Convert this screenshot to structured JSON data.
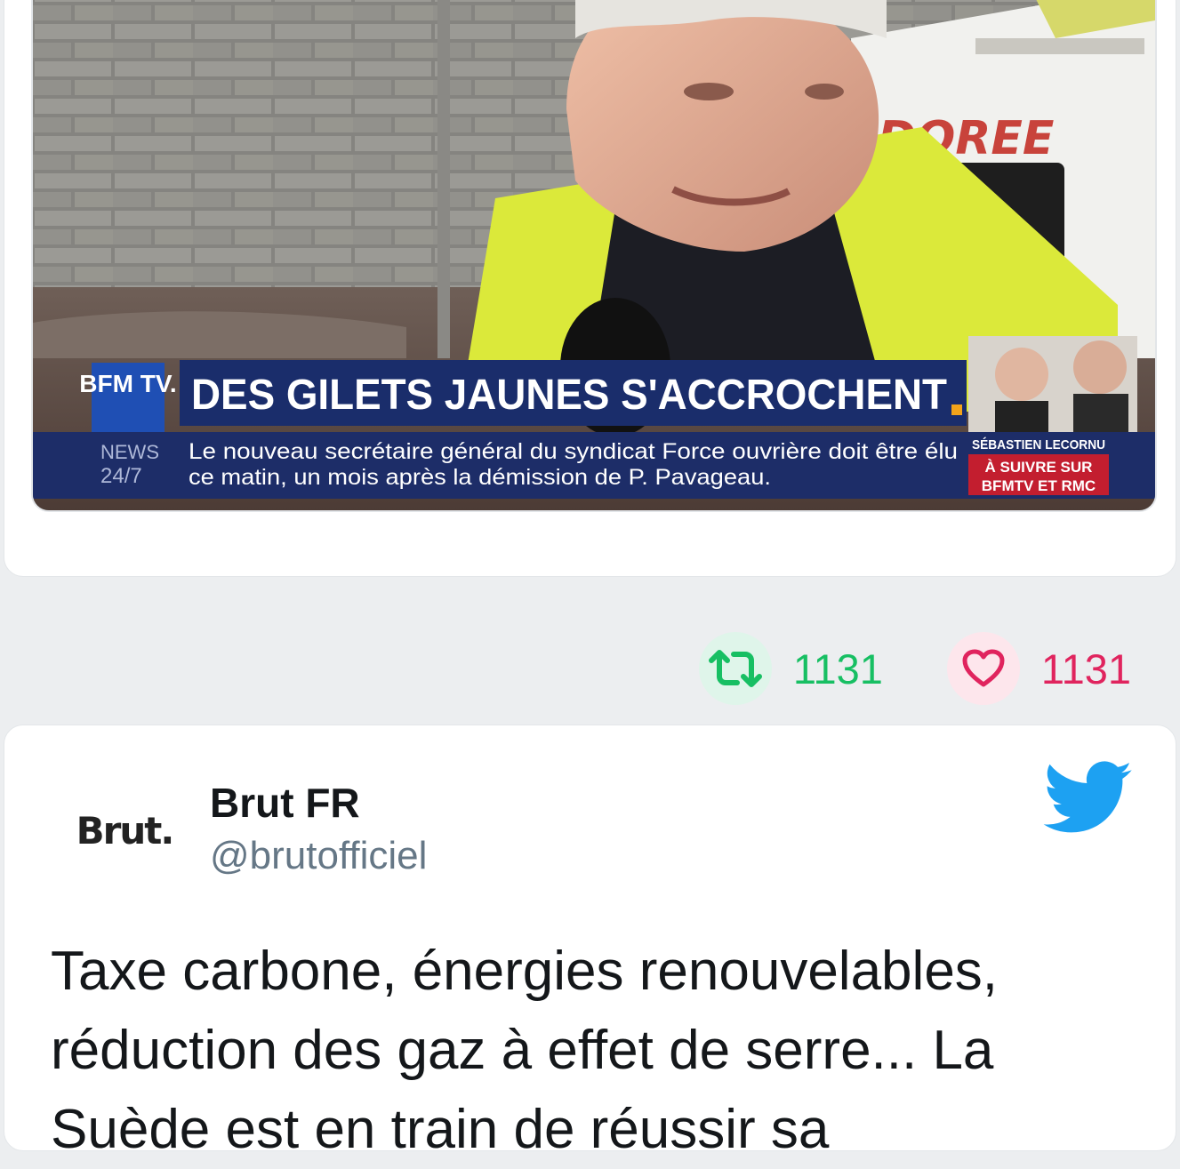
{
  "embedded_video": {
    "channel_logo": "BFM TV.",
    "headline": "DES GILETS JAUNES S'ACCROCHENT",
    "news_label_line1": "NEWS",
    "news_label_line2": "24/7",
    "ticker_line1": "Le nouveau secrétaire général du syndicat Force ouvrière doit être élu",
    "ticker_line2": "ce matin, un mois après la démission de P. Pavageau.",
    "guest_name": "SÉBASTIEN LECORNU",
    "promo_line1": "À SUIVRE SUR",
    "promo_line2": "BFMTV ET RMC",
    "truck_text": "DOREE"
  },
  "actions": {
    "retweet_count": "1131",
    "like_count": "1131"
  },
  "tweet": {
    "avatar_text": "Brut.",
    "display_name": "Brut FR",
    "handle": "@brutofficiel",
    "text": "Taxe carbone, énergies renouvelables, réduction des gaz à effet de serre... La Suède est en train de réussir sa"
  },
  "colors": {
    "retweet": "#17bf63",
    "like": "#e0245e",
    "twitter_blue": "#1da1f2"
  },
  "icons": [
    "retweet-icon",
    "heart-icon",
    "twitter-bird-icon"
  ]
}
